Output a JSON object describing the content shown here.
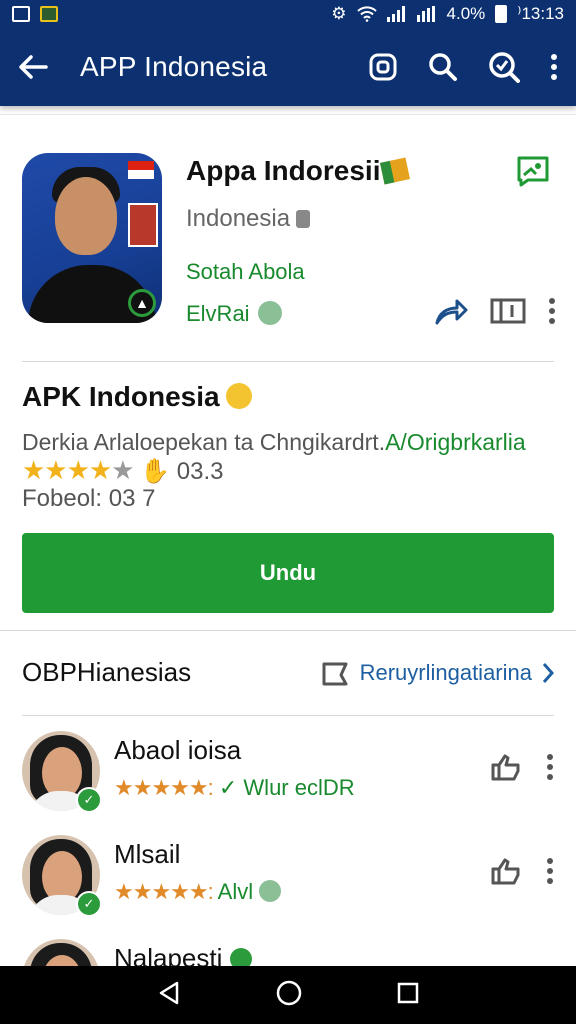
{
  "status_bar": {
    "battery": "4.0%",
    "time": "⁾13:13"
  },
  "app_bar": {
    "title": "APP Indonesia",
    "back_icon": "arrow-left-icon",
    "actions": [
      "screen-icon",
      "search-icon",
      "tag-search-icon",
      "more-vert-icon"
    ],
    "bg_color": "#0d3170"
  },
  "app_info": {
    "name": "Appa Indoresii",
    "developer": "Indonesia",
    "subtitle": "Sotah Abola",
    "meta": "ElvRai"
  },
  "details": {
    "title": "APK Indonesia",
    "description_grey": "Derkia Arlaloepekan ta Chngikardrt.",
    "description_green": "A/Origbrkarlia",
    "rating_value": "03.3",
    "rating_stars": 4,
    "count": "Fobeol: 03 7"
  },
  "install_button": {
    "label": "Undu",
    "color": "#1f9a34"
  },
  "list_section": {
    "header": "OBPHianesias",
    "link": "Reruyrlingatiarina"
  },
  "list_items": [
    {
      "name": "Abaol ioisa",
      "sub": "Wlur eclDR"
    },
    {
      "name": "Mlsail",
      "sub": "Alvl"
    },
    {
      "name": "Nalapesti",
      "sub": ""
    }
  ]
}
